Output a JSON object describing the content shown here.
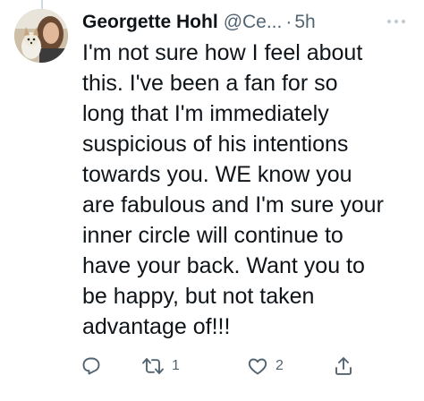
{
  "tweet": {
    "display_name": "Georgette Hohl",
    "handle": "@Ce...",
    "separator": "·",
    "time": "5h",
    "text": "I'm not sure how I feel about\nthis. I've been a fan for so\nlong that I'm immediately\nsuspicious of his intentions\ntowards you. WE know you\nare fabulous and I'm sure your\ninner circle will continue to\nhave your back. Want you to\nbe happy, but not taken\nadvantage of!!!",
    "retweet_count": "1",
    "like_count": "2"
  },
  "icons": {
    "more": "more-dots-icon",
    "reply": "reply-icon",
    "retweet": "retweet-icon",
    "like": "heart-icon",
    "share": "share-icon"
  },
  "colors": {
    "text_primary": "#0f1419",
    "text_secondary": "#536471",
    "thread_line": "#cfd9de"
  }
}
